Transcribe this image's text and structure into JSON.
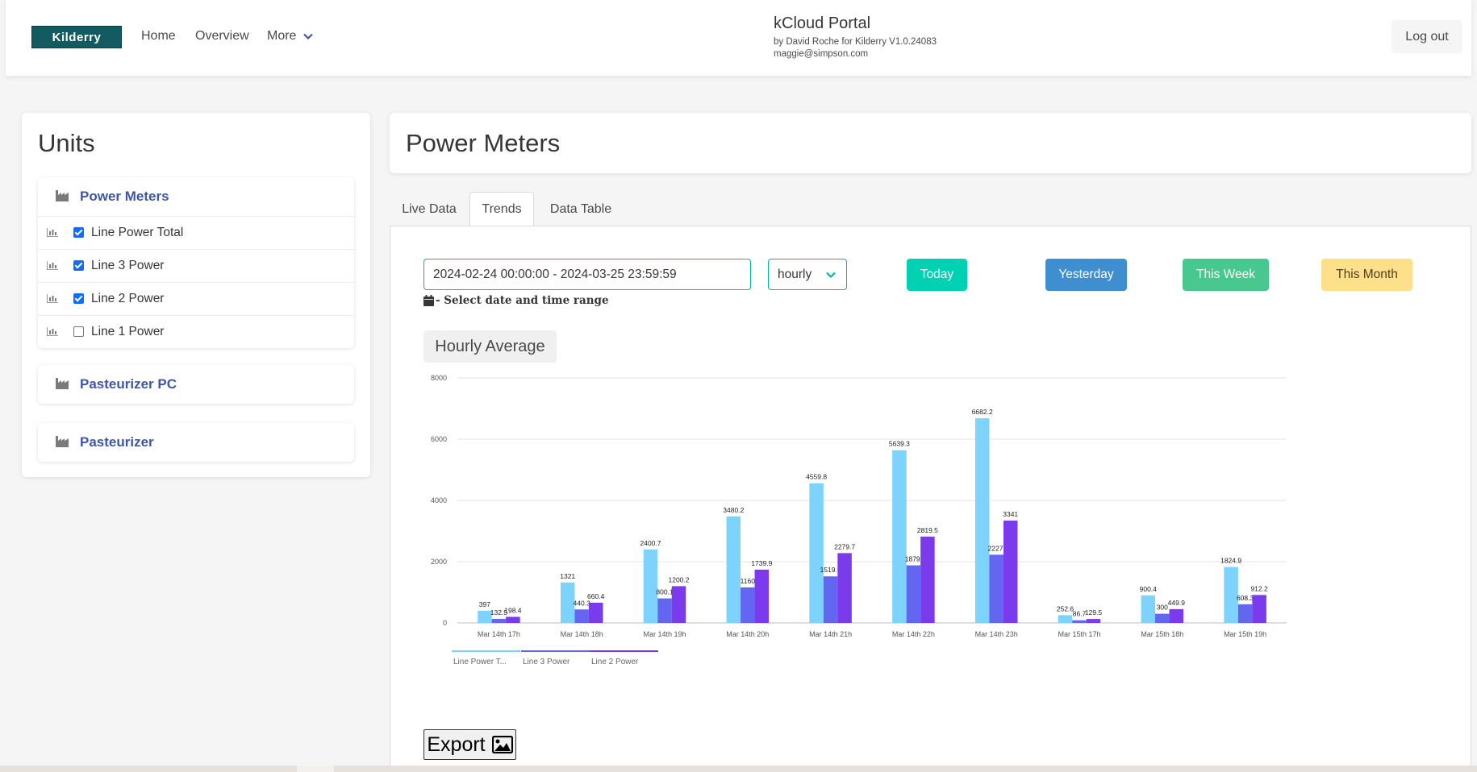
{
  "nav": {
    "logo_text": "Kilderry",
    "home": "Home",
    "overview": "Overview",
    "more": "More",
    "brand_title": "kCloud Portal",
    "brand_sub": "by David Roche for Kilderry V1.0.24083",
    "user_email": "maggie@simpson.com",
    "logout": "Log out"
  },
  "sidebar": {
    "title": "Units",
    "groups": [
      {
        "title": "Power Meters",
        "items": [
          {
            "label": "Line Power Total",
            "checked": true
          },
          {
            "label": "Line 3 Power",
            "checked": true
          },
          {
            "label": "Line 2 Power",
            "checked": true
          },
          {
            "label": "Line 1 Power",
            "checked": false
          }
        ]
      },
      {
        "title": "Pasteurizer PC"
      },
      {
        "title": "Pasteurizer"
      }
    ]
  },
  "main": {
    "title": "Power Meters",
    "tabs": [
      "Live Data",
      "Trends",
      "Data Table"
    ],
    "active_tab": "Trends",
    "date_range": "2024-02-24 00:00:00 - 2024-03-25 23:59:59",
    "date_hint": "- Select date and time range",
    "interval": "hourly",
    "buttons": {
      "today": "Today",
      "yesterday": "Yesterday",
      "this_week": "This Week",
      "this_month": "This Month"
    },
    "chart_heading": "Hourly Average",
    "export_label": "Export"
  },
  "colors": {
    "accent": "#00d1b2",
    "link": "#3e56a6",
    "series_total": "#7dd3fc",
    "series_line3": "#6366f1",
    "series_line2": "#7c3aed"
  },
  "chart_data": {
    "type": "bar",
    "categories": [
      "Mar 14th 17h",
      "Mar 14th 18h",
      "Mar 14th 19h",
      "Mar 14th 20h",
      "Mar 14th 21h",
      "Mar 14th 22h",
      "Mar 14th 23h",
      "Mar 15th 17h",
      "Mar 15th 18h",
      "Mar 15th 19h"
    ],
    "series": [
      {
        "name": "Line Power T...",
        "values": [
          397,
          1321,
          2400.7,
          3480.2,
          4559.8,
          5639.3,
          6682.2,
          252.6,
          900.4,
          1824.9
        ]
      },
      {
        "name": "Line 3 Power",
        "values": [
          132.5,
          440.3,
          800.1,
          1160,
          1519.9,
          1879.8,
          2227.4,
          86.7,
          300,
          608.3
        ]
      },
      {
        "name": "Line 2 Power",
        "values": [
          198.4,
          660.4,
          1200.2,
          1739.9,
          2279.7,
          2819.5,
          3341,
          129.5,
          449.9,
          912.2
        ]
      }
    ],
    "value_labels": [
      [
        "397",
        "1321",
        "2400.7",
        "3480.2",
        "4559.8",
        "5639.3",
        "6682.2",
        "252.6",
        "900.4",
        "1824.9"
      ],
      [
        "132.5",
        "440.3",
        "800.1",
        "1160",
        "1519.9",
        "1879.",
        "2227.",
        "86.7",
        "300",
        "608.3"
      ],
      [
        "198.4",
        "660.4",
        "1200.2",
        "1739.9",
        "2279.7",
        "2819.5",
        "3341",
        "129.5",
        "449.9",
        "912.2"
      ]
    ],
    "yticks": [
      "0",
      "2000",
      "4000",
      "6000",
      "8000"
    ],
    "ylim": [
      0,
      8000
    ],
    "grid": true,
    "legend": "bottom-left"
  }
}
